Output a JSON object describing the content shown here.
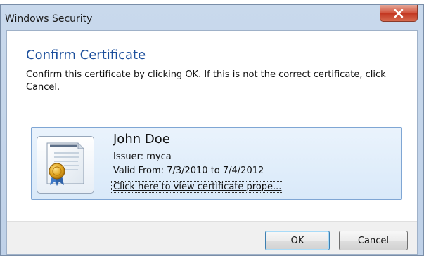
{
  "window": {
    "title": "Windows Security"
  },
  "dialog": {
    "heading": "Confirm Certificate",
    "message": "Confirm this certificate by clicking OK. If this is not the correct certificate, click Cancel."
  },
  "certificate": {
    "name": "John Doe",
    "issuer": "Issuer: myca",
    "validity": "Valid From: 7/3/2010 to 7/4/2012",
    "link_text": "Click here to view certificate prope..."
  },
  "buttons": {
    "ok": "OK",
    "cancel": "Cancel"
  },
  "icons": {
    "close": "close-icon",
    "certificate": "certificate-icon"
  },
  "colors": {
    "heading": "#1c4f9c",
    "card_border": "#7fa6d4",
    "close_button": "#c23520",
    "default_button_border": "#3c7fb1"
  }
}
